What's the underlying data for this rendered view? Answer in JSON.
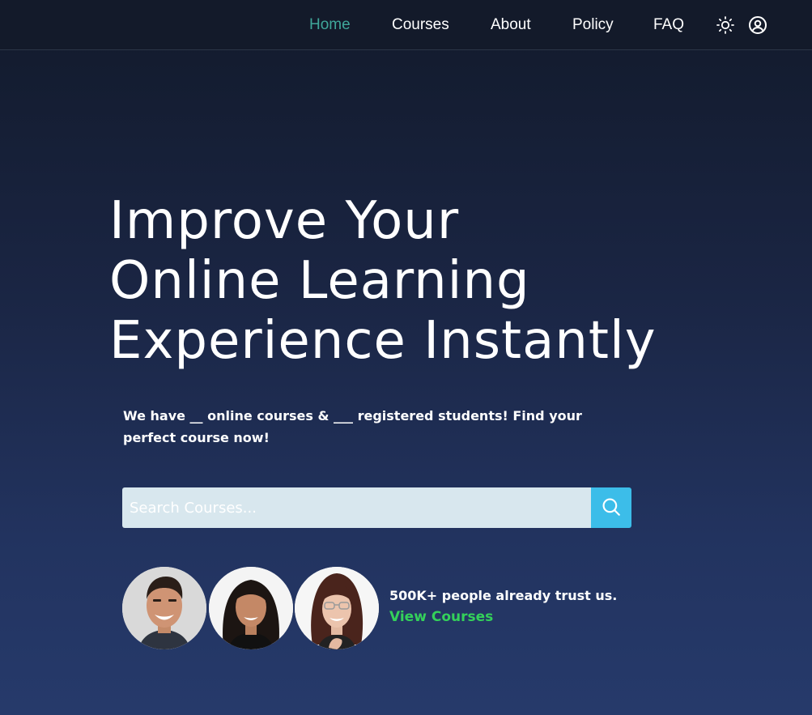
{
  "nav": {
    "links": [
      {
        "label": "Home",
        "active": true
      },
      {
        "label": "Courses",
        "active": false
      },
      {
        "label": "About",
        "active": false
      },
      {
        "label": "Policy",
        "active": false
      },
      {
        "label": "FAQ",
        "active": false
      }
    ],
    "icons": [
      "sun-icon",
      "user-circle-icon"
    ],
    "active_color": "#3fa79a"
  },
  "hero": {
    "title_lines": [
      "Improve Your",
      "Online Learning",
      "Experience Instantly"
    ],
    "subtitle": "We have __ online courses & ___ registered students! Find your perfect course now!"
  },
  "search": {
    "placeholder": "Search Courses...",
    "value": "",
    "button_icon": "search-icon",
    "button_color": "#3cbde9"
  },
  "social_proof": {
    "avatars": [
      "avatar-man-smiling",
      "avatar-woman-curly-hair",
      "avatar-woman-glasses"
    ],
    "trust_text": "500K+ people already trust us.",
    "link_label": "View Courses",
    "link_color": "#34d15a"
  }
}
